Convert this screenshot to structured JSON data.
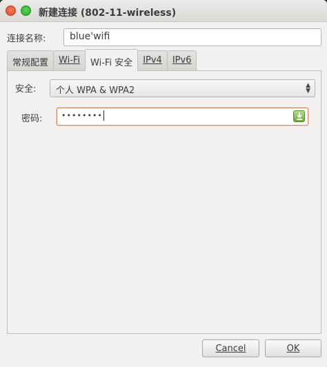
{
  "window": {
    "title": "新建连接 (802-11-wireless)"
  },
  "connection_name": {
    "label": "连接名称:",
    "value": "blue'wifi"
  },
  "tabs": [
    {
      "label": "常规配置"
    },
    {
      "label": "Wi-Fi"
    },
    {
      "label": "Wi-Fi 安全"
    },
    {
      "label": "IPv4"
    },
    {
      "label": "IPv6"
    }
  ],
  "active_tab": "Wi-Fi 安全",
  "security": {
    "label": "安全:",
    "selected": "个人 WPA & WPA2"
  },
  "password": {
    "label": "密码:",
    "masked_value": "••••••••"
  },
  "buttons": {
    "cancel": "Cancel",
    "ok": "OK"
  },
  "icons": {
    "close": "close-icon",
    "maximize": "maximize-icon",
    "password_menu": "key-menu-icon",
    "combo_arrow": "updown-arrows-icon"
  }
}
